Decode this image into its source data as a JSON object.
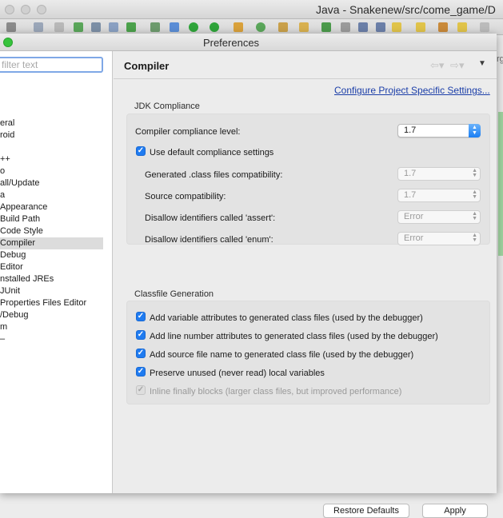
{
  "ide": {
    "title": "Java - Snakenew/src/come_game/D"
  },
  "dialog": {
    "title": "Preferences",
    "filter": {
      "placeholder": "filter text",
      "value": ""
    },
    "tree": [
      "eral",
      "roid",
      "++",
      "o",
      "all/Update",
      "a",
      "Appearance",
      "Build Path",
      "Code Style",
      "Compiler",
      "Debug",
      "Editor",
      "nstalled JREs",
      "JUnit",
      "Properties Files Editor",
      "/Debug",
      "m",
      "–"
    ],
    "selected_tree_index": 9,
    "page": {
      "title": "Compiler",
      "config_link": "Configure Project Specific Settings...",
      "jdk_section": {
        "label": "JDK Compliance",
        "compliance_level_label": "Compiler compliance level:",
        "compliance_level_value": "1.7",
        "use_default_label": "Use default compliance settings",
        "use_default_checked": true,
        "rows": [
          {
            "label": "Generated .class files compatibility:",
            "value": "1.7"
          },
          {
            "label": "Source compatibility:",
            "value": "1.7"
          },
          {
            "label": "Disallow identifiers called 'assert':",
            "value": "Error"
          },
          {
            "label": "Disallow identifiers called 'enum':",
            "value": "Error"
          }
        ]
      },
      "classfile_section": {
        "label": "Classfile Generation",
        "options": [
          {
            "label": "Add variable attributes to generated class files (used by the debugger)",
            "checked": true,
            "enabled": true
          },
          {
            "label": "Add line number attributes to generated class files (used by the debugger)",
            "checked": true,
            "enabled": true
          },
          {
            "label": "Add source file name to generated class file (used by the debugger)",
            "checked": true,
            "enabled": true
          },
          {
            "label": "Preserve unused (never read) local variables",
            "checked": true,
            "enabled": true
          },
          {
            "label": "Inline finally blocks (larger class files, but improved performance)",
            "checked": true,
            "enabled": false
          }
        ]
      },
      "buttons": {
        "restore_defaults": "Restore Defaults",
        "apply": "Apply"
      }
    }
  },
  "colors": {
    "accent": "#1f7bf0",
    "link": "#1b3ea8",
    "green_button": "#36c33c"
  }
}
